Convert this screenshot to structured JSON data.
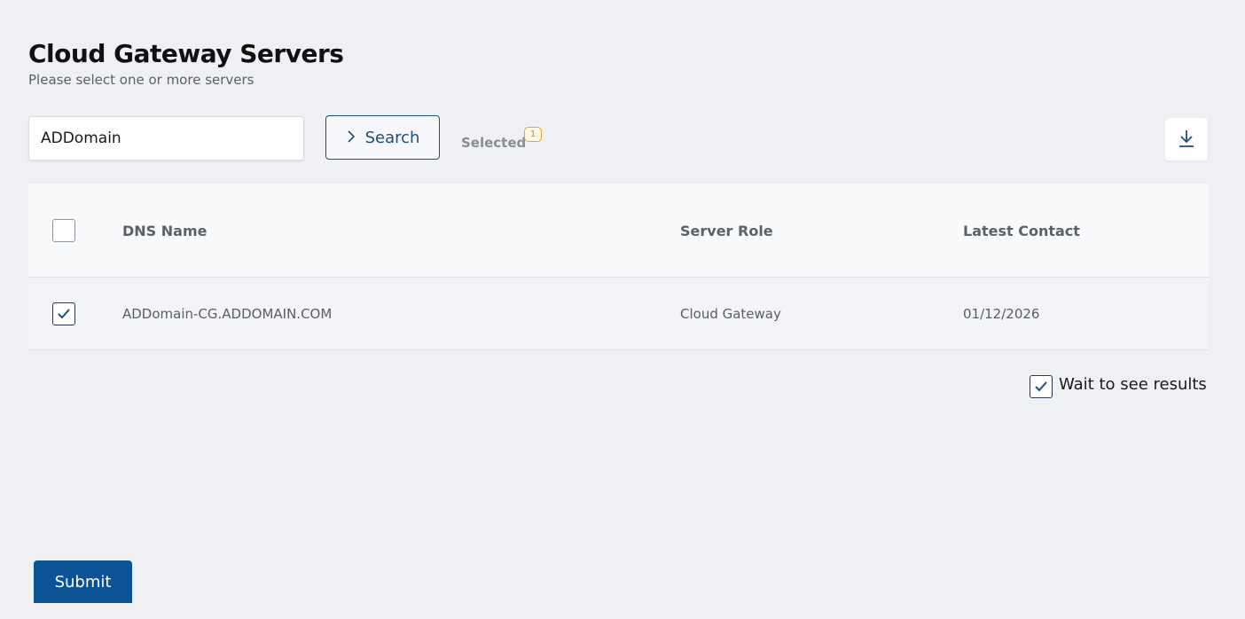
{
  "page": {
    "title": "Cloud Gateway Servers",
    "subtitle": "Please select one or more servers"
  },
  "search": {
    "value": "ADDomain",
    "button_label": "Search"
  },
  "selection": {
    "label": "Selected",
    "count": "1"
  },
  "table": {
    "columns": [
      "DNS Name",
      "Server Role",
      "Latest Contact"
    ],
    "rows": [
      {
        "checked": true,
        "dns_name": "ADDomain-CG.ADDOMAIN.COM",
        "server_role": "Cloud Gateway",
        "latest_contact": "01/12/2026"
      }
    ]
  },
  "options": {
    "wait_label": "Wait to see results",
    "wait_checked": true
  },
  "actions": {
    "submit_label": "Submit"
  },
  "icons": {
    "search": "chevron-right-icon",
    "download": "download-icon",
    "check": "checkmark-icon"
  },
  "colors": {
    "accent": "#0b5394",
    "badge": "#e7a62f"
  }
}
